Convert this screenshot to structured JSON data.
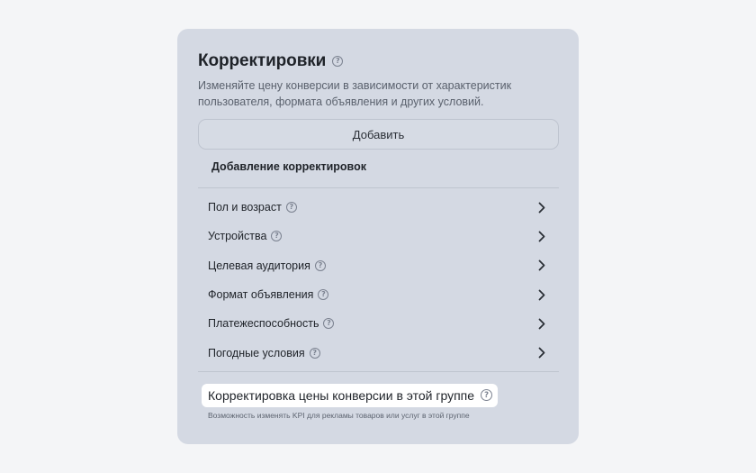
{
  "card": {
    "title": "Корректировки",
    "help_icon": "question-circle-icon",
    "description": "Изменяйте цену конверсии в зависимости от характеристик пользователя, формата объявления и других условий.",
    "add_button_label": "Добавить",
    "section_title": "Добавление корректировок",
    "items": [
      {
        "label": "Пол и возраст"
      },
      {
        "label": "Устройства"
      },
      {
        "label": "Целевая аудитория"
      },
      {
        "label": "Формат объявления"
      },
      {
        "label": "Платежеспособность"
      },
      {
        "label": "Погодные условия"
      }
    ],
    "conversion_adjustment": {
      "label": "Корректировка цены конверсии в этой группе",
      "note": "Возможность изменять KPI для рекламы товаров или услуг в этой группе"
    }
  },
  "colors": {
    "page_bg": "#f4f5f7",
    "card_bg": "#d4d9e3",
    "text": "#1f2329",
    "muted": "#5a616d"
  }
}
